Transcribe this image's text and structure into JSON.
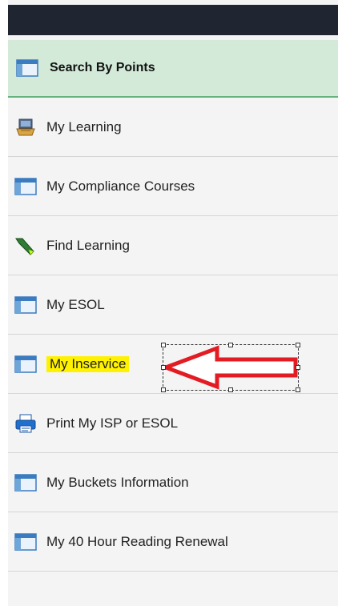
{
  "header": {
    "title": "Search By Points",
    "icon": "window-icon"
  },
  "nav": {
    "items": [
      {
        "label": "My Learning",
        "icon": "learning-icon"
      },
      {
        "label": "My Compliance Courses",
        "icon": "window-icon"
      },
      {
        "label": "Find Learning",
        "icon": "flashlight-icon"
      },
      {
        "label": "My ESOL",
        "icon": "window-icon"
      },
      {
        "label": "My Inservice",
        "icon": "window-icon",
        "highlighted": true
      },
      {
        "label": "Print My ISP or ESOL",
        "icon": "printer-icon"
      },
      {
        "label": "My Buckets Information",
        "icon": "window-icon"
      },
      {
        "label": "My 40 Hour Reading Renewal",
        "icon": "window-icon"
      }
    ]
  },
  "colors": {
    "topbar": "#1f2632",
    "header_bg": "#d3ead9",
    "header_border": "#66b27c",
    "highlight": "#fff200",
    "arrow": "#e31b23"
  }
}
